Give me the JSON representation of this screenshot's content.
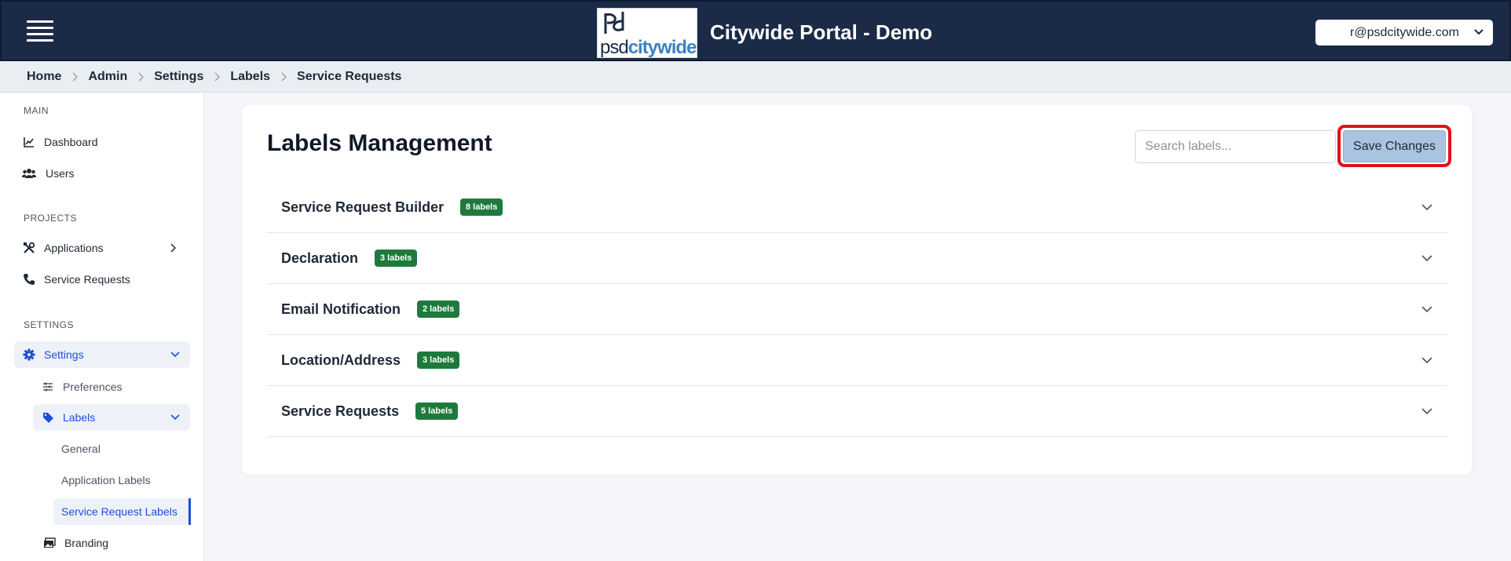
{
  "header": {
    "menu_icon": "hamburger-menu-icon",
    "logo": {
      "psd": "psd",
      "citywide": "citywide"
    },
    "title": "Citywide Portal - Demo",
    "user_email": "r@psdcitywide.com",
    "colors": {
      "bar": "#1b2a47",
      "accent": "#3b82c4"
    }
  },
  "breadcrumb": [
    "Home",
    "Admin",
    "Settings",
    "Labels",
    "Service Requests"
  ],
  "sidebar": {
    "main_title": "MAIN",
    "dashboard": "Dashboard",
    "users": "Users",
    "projects_title": "PROJECTS",
    "applications": "Applications",
    "service_requests": "Service Requests",
    "settings_title": "SETTINGS",
    "settings": "Settings",
    "preferences": "Preferences",
    "labels": "Labels",
    "general": "General",
    "application_labels": "Application Labels",
    "service_request_labels": "Service Request Labels",
    "branding": "Branding"
  },
  "main": {
    "title": "Labels Management",
    "search_placeholder": "Search labels...",
    "save_label": "Save Changes",
    "save_highlight_color": "#e0121a",
    "badge_color": "#1e7a3c",
    "sections": [
      {
        "title": "Service Request Builder",
        "count": "8 labels"
      },
      {
        "title": "Declaration",
        "count": "3 labels"
      },
      {
        "title": "Email Notification",
        "count": "2 labels"
      },
      {
        "title": "Location/Address",
        "count": "3 labels"
      },
      {
        "title": "Service Requests",
        "count": "5 labels"
      }
    ]
  }
}
